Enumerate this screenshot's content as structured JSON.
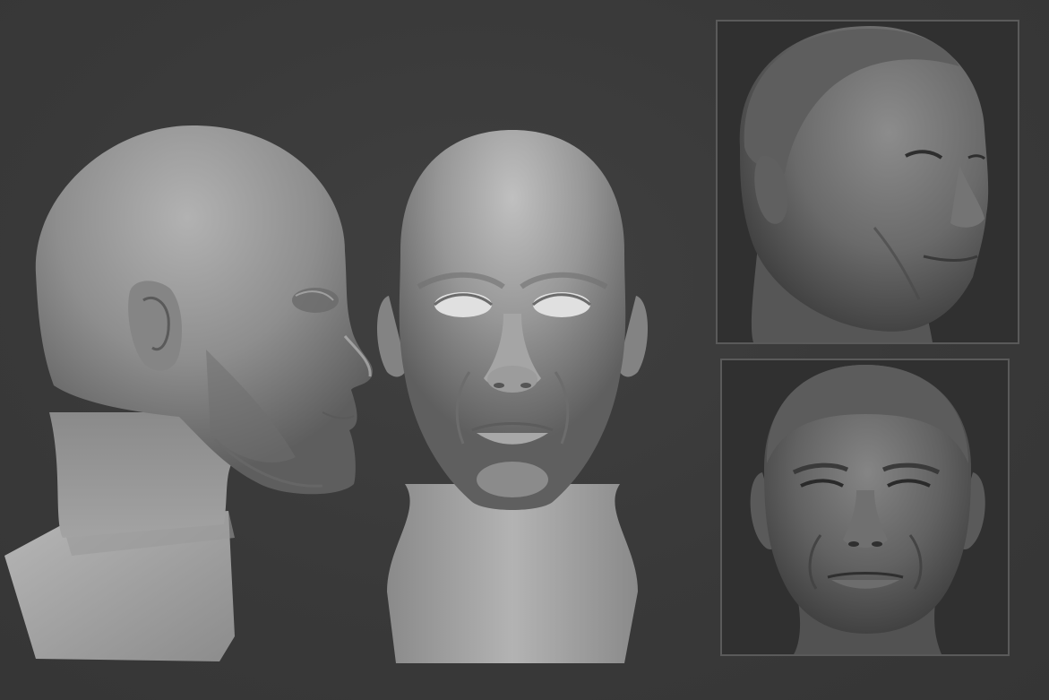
{
  "scene": {
    "background_color": "#3a3a3a",
    "frame_border_color": "#5a5a5a"
  },
  "sculpts": {
    "profile_view": {
      "icon": "clay-head-profile",
      "material": "grey-clay"
    },
    "front_view": {
      "icon": "clay-head-front",
      "material": "grey-clay"
    }
  },
  "references": {
    "three_quarter": {
      "icon": "reference-head-three-quarter",
      "material": "detailed-clay"
    },
    "front": {
      "icon": "reference-head-front",
      "material": "detailed-clay"
    }
  }
}
